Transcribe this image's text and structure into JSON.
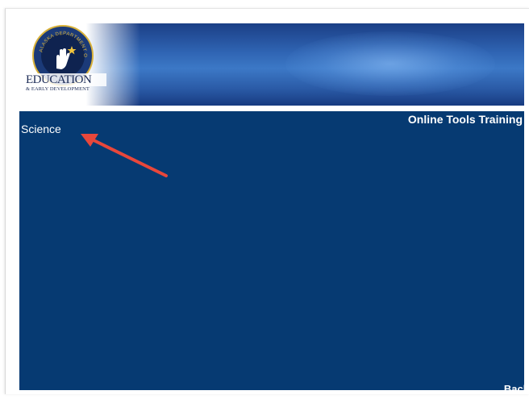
{
  "banner": {
    "logo_line1": "EDUCATION",
    "logo_line2": "& EARLY DEVELOPMENT",
    "logo_ring_text": "ALASKA DEPARTMENT OF",
    "icon": "alaska-education-seal-icon"
  },
  "main": {
    "section_label": "Science",
    "title": "Online Tools Training",
    "back_label": "Back"
  },
  "annotation": {
    "icon": "red-arrow-icon",
    "color": "#e8473b"
  },
  "colors": {
    "panel": "#063a72",
    "banner_dark": "#1b3f86",
    "banner_light": "#3c78c6",
    "seal_gold": "#d9b23a"
  }
}
